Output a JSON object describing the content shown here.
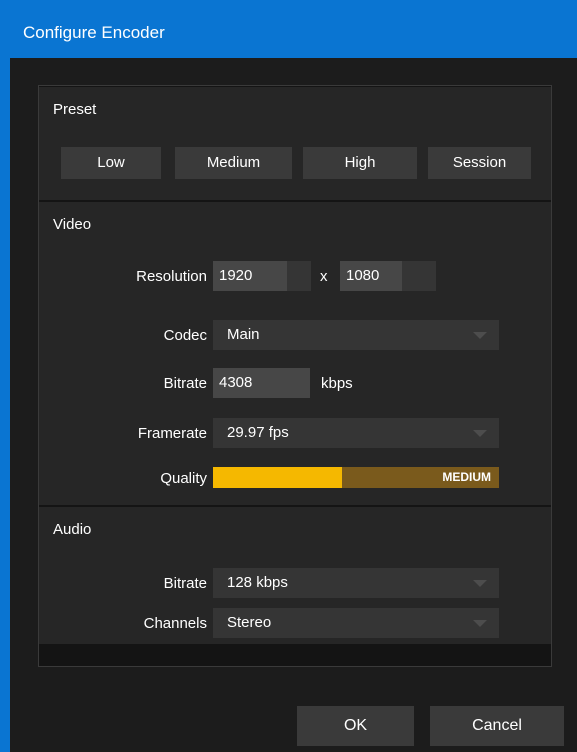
{
  "window": {
    "title": "Configure Encoder"
  },
  "preset": {
    "title": "Preset",
    "buttons": [
      "Low",
      "Medium",
      "High",
      "Session"
    ]
  },
  "video": {
    "title": "Video",
    "resolution_label": "Resolution",
    "width": "1920",
    "x_separator": "x",
    "height": "1080",
    "codec_label": "Codec",
    "codec_value": "Main",
    "bitrate_label": "Bitrate",
    "bitrate_value": "4308",
    "bitrate_unit": "kbps",
    "framerate_label": "Framerate",
    "framerate_value": "29.97 fps",
    "quality_label": "Quality",
    "quality_text": "MEDIUM",
    "quality_level": 0.45,
    "quality_fill_color": "#f5b800",
    "quality_track_color": "#7a5a1c"
  },
  "audio": {
    "title": "Audio",
    "bitrate_label": "Bitrate",
    "bitrate_value": "128 kbps",
    "channels_label": "Channels",
    "channels_value": "Stereo"
  },
  "footer": {
    "ok_label": "OK",
    "cancel_label": "Cancel"
  },
  "colors": {
    "titlebar": "#0a75d2",
    "dialog_bg": "#1c1c1c",
    "section_bg": "#262626",
    "control_bg": "#353535"
  }
}
